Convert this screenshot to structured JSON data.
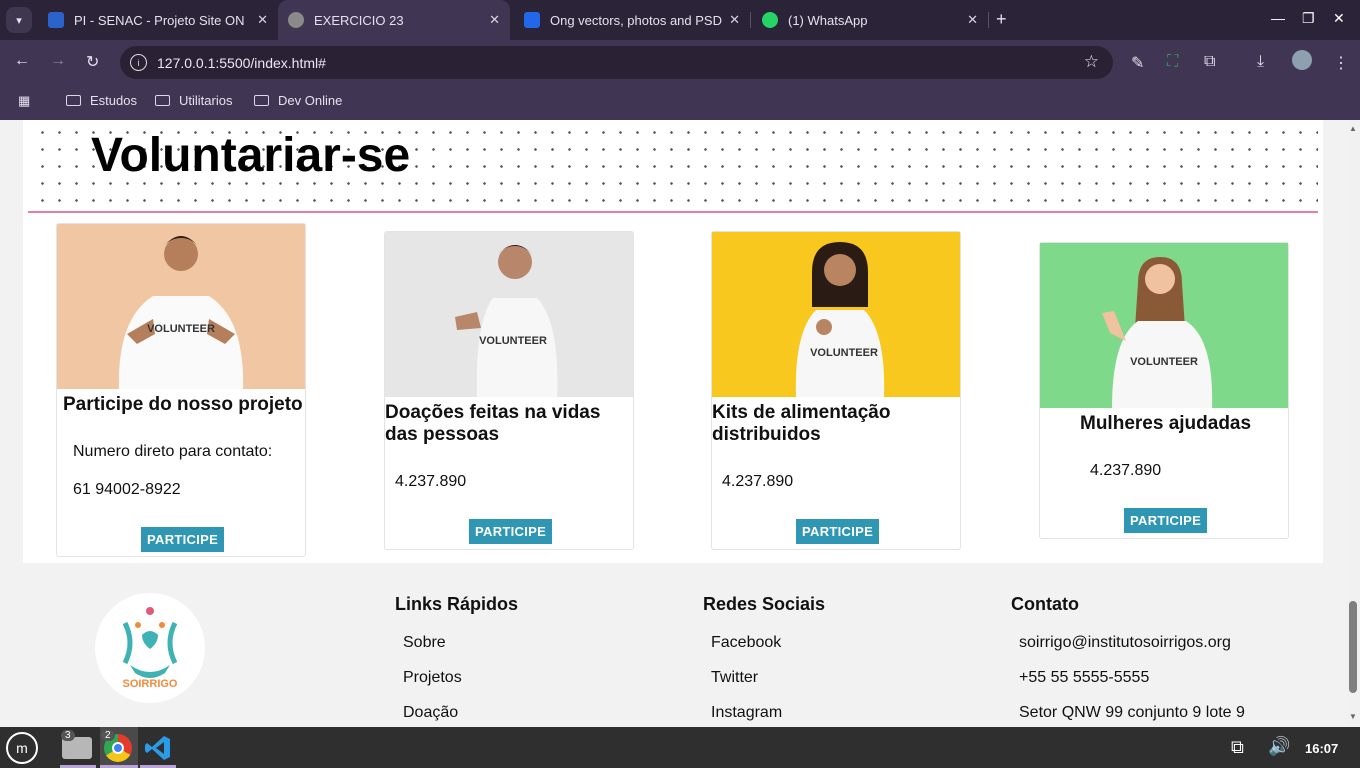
{
  "browser": {
    "tabs": [
      {
        "title": "PI - SENAC - Projeto Site ONG",
        "color": "#2a63c9"
      },
      {
        "title": "EXERCICIO 23",
        "color": "#8a8a8a",
        "active": true
      },
      {
        "title": "Ong vectors, photos and PSD",
        "color": "#2167e8"
      },
      {
        "title": "(1) WhatsApp",
        "color": "#25d366"
      }
    ],
    "url": "127.0.0.1:5500/index.html#",
    "bookmarks": [
      "Estudos",
      "Utilitarios",
      "Dev Online"
    ]
  },
  "page": {
    "section_title": "Voluntariar-se",
    "cards": [
      {
        "title": "Participe do nosso projeto",
        "line1": "Numero direto para contato:",
        "line2": "61 94002-8922",
        "button": "PARTICIPE",
        "bg": "#f0c7a2"
      },
      {
        "title": "Doações feitas na vidas das pessoas",
        "value": "4.237.890",
        "button": "PARTICIPE",
        "bg": "#e6e6e6"
      },
      {
        "title": "Kits de alimentação distribuidos",
        "value": "4.237.890",
        "button": "PARTICIPE",
        "bg": "#f8c81e"
      },
      {
        "title": "Mulheres ajudadas",
        "value": "4.237.890",
        "button": "PARTICIPE",
        "bg": "#7fd98b"
      }
    ],
    "shirt_text": "VOLUNTEER",
    "footer": {
      "logo_text": "SOIRRIGO",
      "quick_links": {
        "heading": "Links Rápidos",
        "items": [
          "Sobre",
          "Projetos",
          "Doação"
        ]
      },
      "social": {
        "heading": "Redes Sociais",
        "items": [
          "Facebook",
          "Twitter",
          "Instagram"
        ]
      },
      "contact": {
        "heading": "Contato",
        "items": [
          "soirrigo@institutosoirrigos.org",
          "+55 55 5555-5555",
          "Setor QNW 99 conjunto 9 lote 9"
        ]
      }
    }
  },
  "taskbar": {
    "files_count": "3",
    "chrome_count": "2",
    "clock": "16:07"
  }
}
